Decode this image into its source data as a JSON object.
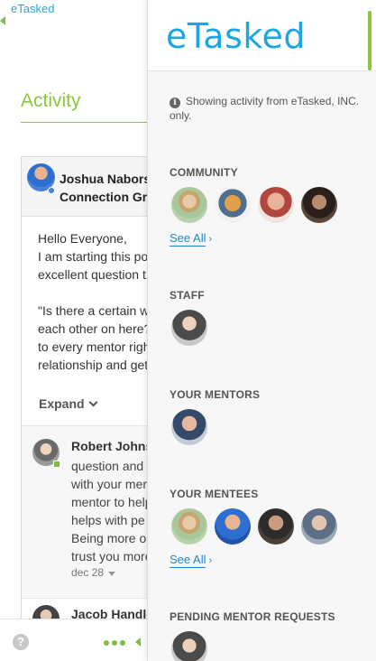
{
  "background": {
    "logo": "eTasked",
    "page_title": "Activity",
    "post": {
      "author": "Joshua Nabors",
      "group": "Connection Gr",
      "lines": [
        "Hello Everyone,",
        "I am starting this po",
        "excellent question t",
        "",
        "\"Is there a certain w",
        "each other on here?",
        "to every mentor righ",
        "relationship and get"
      ],
      "expand_label": "Expand"
    },
    "reply": {
      "author": "Robert Johns",
      "lines": [
        "question and",
        "with your mer",
        "mentor to help",
        "helps with pe",
        "Being more o",
        "trust you more"
      ],
      "date": "dec 28"
    },
    "reply2": {
      "author": "Jacob Handle"
    },
    "help_icon": "?"
  },
  "panel": {
    "brand": "eTasked",
    "notice": "Showing activity from eTasked, INC. only.",
    "info_icon": "i",
    "sections": {
      "community": {
        "title": "COMMUNITY",
        "see_all": "See All"
      },
      "staff": {
        "title": "STAFF"
      },
      "mentors": {
        "title": "YOUR MENTORS"
      },
      "mentees": {
        "title": "YOUR MENTEES",
        "see_all": "See All"
      },
      "pending": {
        "title": "PENDING MENTOR REQUESTS"
      }
    },
    "arrow": "›"
  },
  "colors": {
    "brand_blue": "#1fa6e0",
    "accent_green": "#7ac143",
    "link_blue": "#1f88c9"
  }
}
